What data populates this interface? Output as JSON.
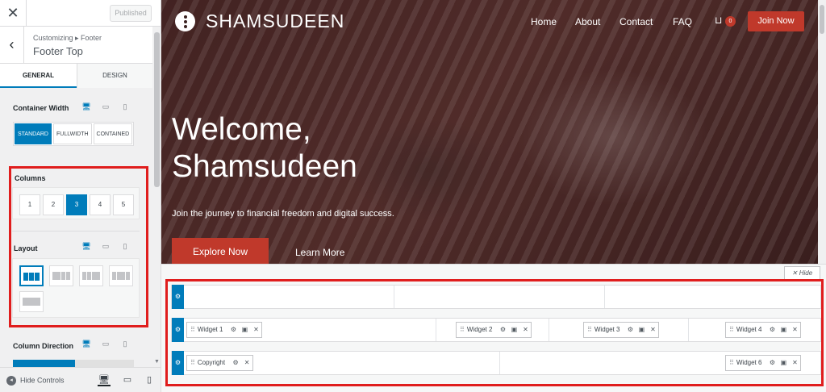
{
  "sidebar": {
    "close_icon": "close-icon",
    "published_label": "Published",
    "breadcrumb": "Customizing ▸ Footer",
    "section_title": "Footer Top",
    "tabs": [
      {
        "label": "General",
        "active": true
      },
      {
        "label": "Design",
        "active": false
      }
    ],
    "container_width": {
      "label": "Container Width",
      "options": [
        "Standard",
        "Fullwidth",
        "Contained"
      ],
      "selected": "Standard"
    },
    "columns": {
      "label": "Columns",
      "options": [
        "1",
        "2",
        "3",
        "4",
        "5"
      ],
      "selected": "3"
    },
    "layout": {
      "label": "Layout",
      "selected_index": 0,
      "option_icons": [
        "equal-thirds-layout-icon",
        "left-wide-layout-icon",
        "right-wide-layout-icon",
        "center-wide-layout-icon",
        "single-stack-layout-icon"
      ]
    },
    "column_direction": {
      "label": "Column Direction"
    },
    "footer": {
      "hide_controls_label": "Hide Controls",
      "devices": [
        "desktop-icon",
        "tablet-icon",
        "mobile-icon"
      ]
    }
  },
  "preview": {
    "site_title": "SHAMSUDEEN",
    "nav": [
      "Home",
      "About",
      "Contact",
      "FAQ"
    ],
    "cart_count": "0",
    "join_label": "Join Now",
    "hero_heading": "Welcome, Shamsudeen",
    "hero_sub": "Join the journey to financial freedom and digital success.",
    "explore_label": "Explore Now",
    "learn_more_label": "Learn More",
    "hide_label": "Hide",
    "hide_icon": "close-icon"
  },
  "footer_builder": {
    "rows": [
      {
        "name": "footer-top-row",
        "widgets": []
      },
      {
        "name": "footer-main-row",
        "widgets": [
          "Widget 1",
          "Widget 2",
          "Widget 3",
          "Widget 4"
        ]
      },
      {
        "name": "footer-bottom-row",
        "widgets": [
          "Copyright",
          "Widget 6"
        ]
      }
    ]
  },
  "colors": {
    "accent": "#007cba",
    "brand_red": "#c0392b",
    "highlight": "#e01d1d"
  }
}
